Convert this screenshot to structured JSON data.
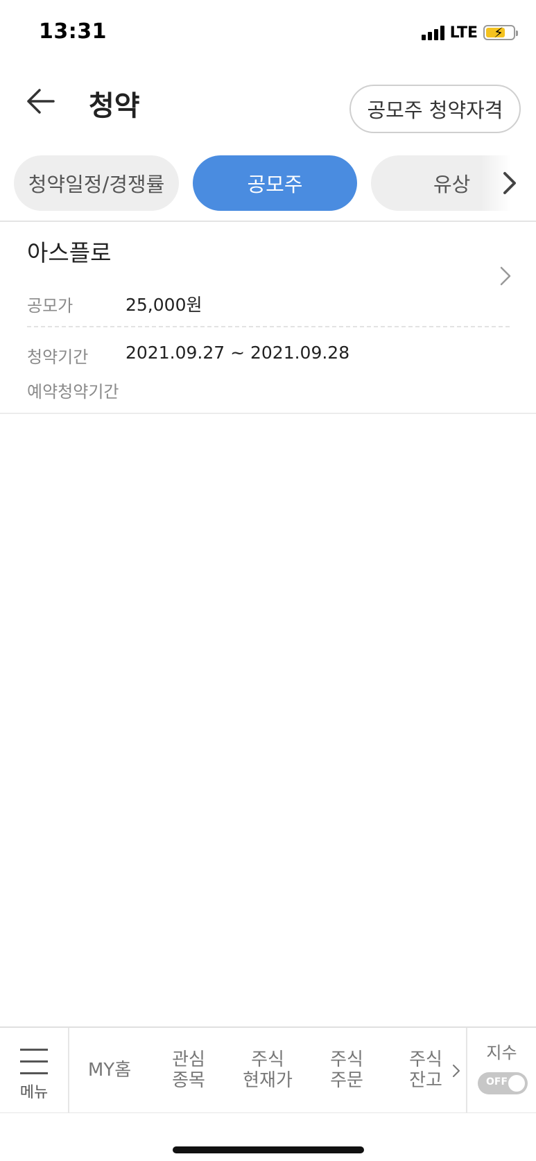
{
  "status_bar": {
    "time": "13:31",
    "network": "LTE",
    "battery_icon": "battery-charging-icon",
    "signal_icon": "signal-bars-icon"
  },
  "header": {
    "title": "청약",
    "back_icon": "arrow-left-icon",
    "eligibility_button": "공모주 청약자격"
  },
  "tabs": [
    {
      "label": "청약일정/경쟁률",
      "active": false
    },
    {
      "label": "공모주",
      "active": true
    },
    {
      "label": "유상",
      "active": false
    }
  ],
  "offering": {
    "name": "아스플로",
    "price_label": "공모가",
    "price_value": "25,000원",
    "period_label": "청약기간",
    "period_value": "2021.09.27 ~ 2021.09.28",
    "reserve_label": "예약청약기간",
    "reserve_value": ""
  },
  "bottom_nav": {
    "menu_label": "메뉴",
    "items": [
      {
        "line1": "MY홈",
        "line2": ""
      },
      {
        "line1": "관심",
        "line2": "종목"
      },
      {
        "line1": "주식",
        "line2": "현재가"
      },
      {
        "line1": "주식",
        "line2": "주문"
      },
      {
        "line1": "주식",
        "line2": "잔고"
      }
    ],
    "index_label": "지수",
    "index_toggle": "OFF"
  },
  "colors": {
    "accent": "#4a8ce0",
    "tab_inactive": "#eeeeee",
    "text": "#222222",
    "label": "#8a8a8a"
  }
}
